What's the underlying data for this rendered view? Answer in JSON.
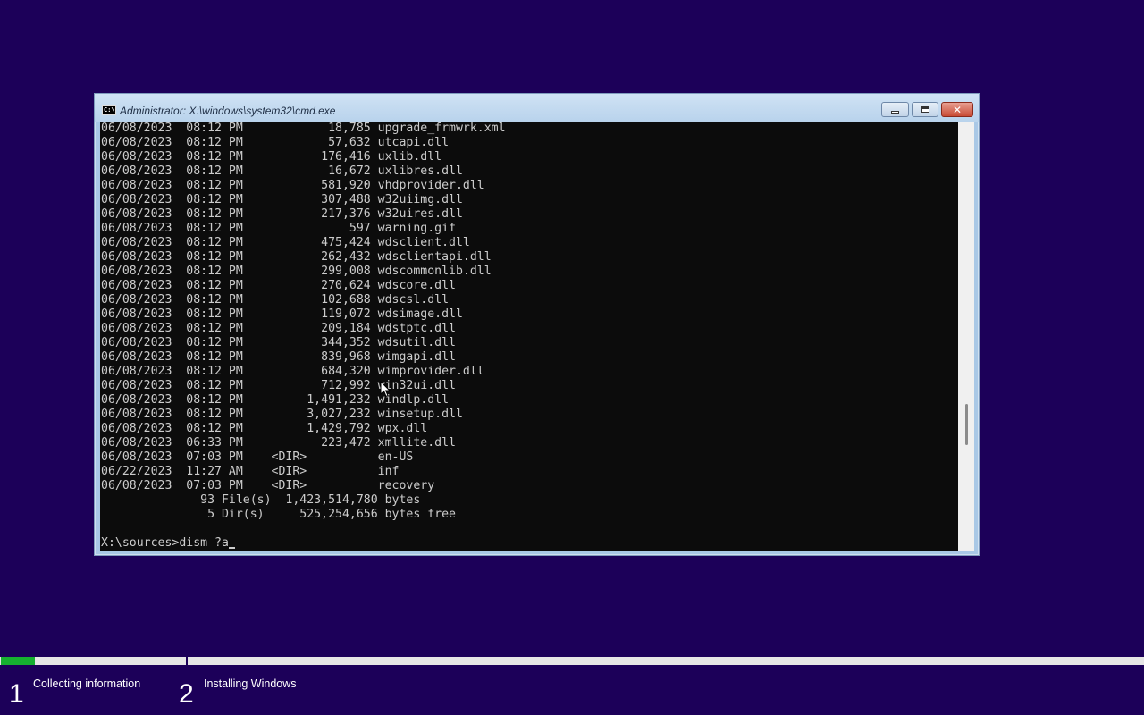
{
  "window": {
    "title": "Administrator: X:\\windows\\system32\\cmd.exe",
    "icon_text": "C:\\",
    "close_glyph": "✕"
  },
  "console": {
    "lines": [
      "06/08/2023  08:12 PM            18,785 upgrade_frmwrk.xml",
      "06/08/2023  08:12 PM            57,632 utcapi.dll",
      "06/08/2023  08:12 PM           176,416 uxlib.dll",
      "06/08/2023  08:12 PM            16,672 uxlibres.dll",
      "06/08/2023  08:12 PM           581,920 vhdprovider.dll",
      "06/08/2023  08:12 PM           307,488 w32uiimg.dll",
      "06/08/2023  08:12 PM           217,376 w32uires.dll",
      "06/08/2023  08:12 PM               597 warning.gif",
      "06/08/2023  08:12 PM           475,424 wdsclient.dll",
      "06/08/2023  08:12 PM           262,432 wdsclientapi.dll",
      "06/08/2023  08:12 PM           299,008 wdscommonlib.dll",
      "06/08/2023  08:12 PM           270,624 wdscore.dll",
      "06/08/2023  08:12 PM           102,688 wdscsl.dll",
      "06/08/2023  08:12 PM           119,072 wdsimage.dll",
      "06/08/2023  08:12 PM           209,184 wdstptc.dll",
      "06/08/2023  08:12 PM           344,352 wdsutil.dll",
      "06/08/2023  08:12 PM           839,968 wimgapi.dll",
      "06/08/2023  08:12 PM           684,320 wimprovider.dll",
      "06/08/2023  08:12 PM           712,992 win32ui.dll",
      "06/08/2023  08:12 PM         1,491,232 windlp.dll",
      "06/08/2023  08:12 PM         3,027,232 winsetup.dll",
      "06/08/2023  08:12 PM         1,429,792 wpx.dll",
      "06/08/2023  06:33 PM           223,472 xmllite.dll",
      "06/08/2023  07:03 PM    <DIR>          en-US",
      "06/22/2023  11:27 AM    <DIR>          inf",
      "06/08/2023  07:03 PM    <DIR>          recovery",
      "              93 File(s)  1,423,514,780 bytes",
      "               5 Dir(s)     525,254,656 bytes free",
      "",
      "X:\\sources>dism ?a"
    ]
  },
  "setup_progress": {
    "progress_fraction": 0.03,
    "steps": [
      {
        "number": "1",
        "label": "Collecting information"
      },
      {
        "number": "2",
        "label": "Installing Windows"
      }
    ]
  },
  "colors": {
    "background": "#1c0059",
    "console_bg": "#0c0c0c",
    "console_text": "#cccccc",
    "progress_fill": "#16b030"
  }
}
